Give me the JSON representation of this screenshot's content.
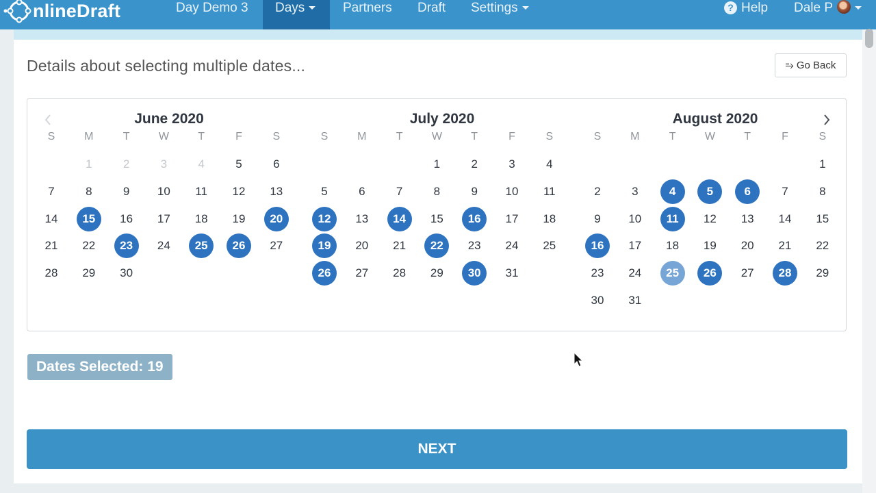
{
  "navbar": {
    "brand_text": "nlineDraft",
    "items": [
      "Day Demo 3",
      "Days",
      "Partners",
      "Draft",
      "Settings"
    ],
    "help_label": "Help",
    "user_label": "Dale P"
  },
  "page": {
    "heading": "Details about selecting multiple dates...",
    "go_back_label": "Go Back",
    "selected_count_label": "Dates Selected: 19",
    "next_label": "NEXT"
  },
  "calendar": {
    "weekday_labels": [
      "S",
      "M",
      "T",
      "W",
      "T",
      "F",
      "S"
    ],
    "months": [
      {
        "title": "June 2020",
        "first_weekday": 1,
        "days_in_month": 30,
        "disabled_days": [
          1,
          2,
          3,
          4
        ],
        "selected_days": [
          15,
          20,
          23,
          25,
          26
        ],
        "hovered_days": []
      },
      {
        "title": "July 2020",
        "first_weekday": 3,
        "days_in_month": 31,
        "disabled_days": [],
        "selected_days": [
          12,
          14,
          16,
          19,
          22,
          26,
          30
        ],
        "hovered_days": []
      },
      {
        "title": "August 2020",
        "first_weekday": 6,
        "days_in_month": 31,
        "disabled_days": [],
        "selected_days": [
          4,
          5,
          6,
          11,
          16,
          26,
          28
        ],
        "hovered_days": [
          25
        ]
      }
    ]
  },
  "colors": {
    "navbar": "#3a93cb",
    "selected_day": "#2e73c0",
    "hovered_day": "#76a5d6",
    "next_button": "#3a92c6",
    "count_badge": "#8db2c7"
  }
}
